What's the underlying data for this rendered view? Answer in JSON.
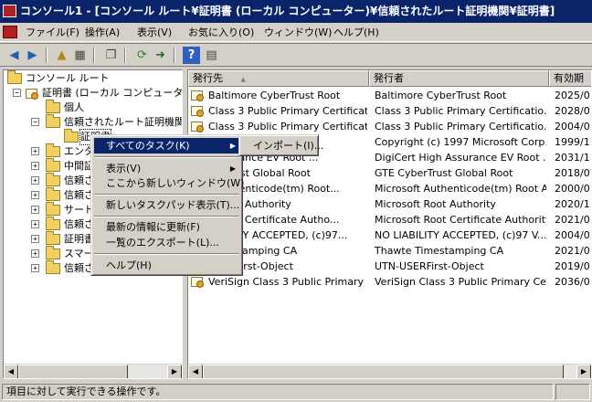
{
  "window": {
    "title": "コンソール1 - [コンソール ルート¥証明書 (ローカル コンピューター)¥信頼されたルート証明機関¥証明書]"
  },
  "menubar": {
    "items": [
      "ファイル(F)",
      "操作(A)",
      "表示(V)",
      "お気に入り(O)",
      "ウィンドウ(W)",
      "ヘルプ(H)"
    ]
  },
  "tree": {
    "items": [
      {
        "label": "コンソール ルート",
        "expander": ""
      },
      {
        "label": "証明書 (ローカル コンピューター)",
        "expander": "−"
      },
      {
        "label": "個人",
        "expander": ""
      },
      {
        "label": "信頼されたルート証明機関",
        "expander": "−"
      },
      {
        "label": "証明書",
        "expander": ""
      },
      {
        "label": "エンター",
        "expander": "+"
      },
      {
        "label": "中間証",
        "expander": "+"
      },
      {
        "label": "信頼さ",
        "expander": "+"
      },
      {
        "label": "信頼さ",
        "expander": "+"
      },
      {
        "label": "サード",
        "expander": "+"
      },
      {
        "label": "信頼さ",
        "expander": "+"
      },
      {
        "label": "証明書",
        "expander": "+"
      },
      {
        "label": "スマー",
        "expander": "+"
      },
      {
        "label": "信頼さ",
        "expander": "+"
      }
    ]
  },
  "list": {
    "columns": [
      "発行先",
      "発行者",
      "有効期"
    ],
    "sort_indicator": "▲",
    "rows": [
      {
        "issued_to": "Baltimore CyberTrust Root",
        "issued_by": "Baltimore CyberTrust Root",
        "expires": "2025/0"
      },
      {
        "issued_to": "Class 3 Public Primary Certificat...",
        "issued_by": "Class 3 Public Primary Certificatio...",
        "expires": "2028/0"
      },
      {
        "issued_to": "Class 3 Public Primary Certificat...",
        "issued_by": "Class 3 Public Primary Certificatio...",
        "expires": "2004/0"
      },
      {
        "issued_to": "...ft Corp.",
        "issued_by": "Copyright (c) 1997 Microsoft Corp.",
        "expires": "1999/1"
      },
      {
        "issued_to": "...ssurance EV Root ...",
        "issued_by": "DigiCert High Assurance EV Root ...",
        "expires": "2031/1"
      },
      {
        "issued_to": "berTrust Global Root",
        "issued_by": "GTE CyberTrust Global Root",
        "expires": "2018/0"
      },
      {
        "issued_to": "t Authenticode(tm) Root...",
        "issued_by": "Microsoft Authenticode(tm) Root A...",
        "expires": "2000/0"
      },
      {
        "issued_to": "ft Root Authority",
        "issued_by": "Microsoft Root Authority",
        "expires": "2020/1"
      },
      {
        "issued_to": "ft Root Certificate Autho...",
        "issued_by": "Microsoft Root Certificate Authority",
        "expires": "2021/0"
      },
      {
        "issued_to": "IABILITY ACCEPTED, (c)97...",
        "issued_by": "NO LIABILITY ACCEPTED, (c)97 V...",
        "expires": "2004/0"
      },
      {
        "issued_to": "Timestamping CA",
        "issued_by": "Thawte Timestamping CA",
        "expires": "2021/0"
      },
      {
        "issued_to": "USERFirst-Object",
        "issued_by": "UTN-USERFirst-Object",
        "expires": "2019/0"
      },
      {
        "issued_to": "VeriSign Class 3 Public Primary ...",
        "issued_by": "VeriSign Class 3 Public Primary Ce...",
        "expires": "2036/0"
      }
    ]
  },
  "context_menu": {
    "all_tasks": "すべてのタスク(K)",
    "view": "表示(V)",
    "new_window": "ここから新しいウィンドウ(W)",
    "new_taskpad": "新しいタスクパッド表示(T)...",
    "refresh": "最新の情報に更新(F)",
    "export_list": "一覧のエクスポート(L)...",
    "help": "ヘルプ(H)"
  },
  "submenu": {
    "import": "インポート(I)..."
  },
  "status": {
    "text": "項目に対して実行できる操作です。"
  }
}
